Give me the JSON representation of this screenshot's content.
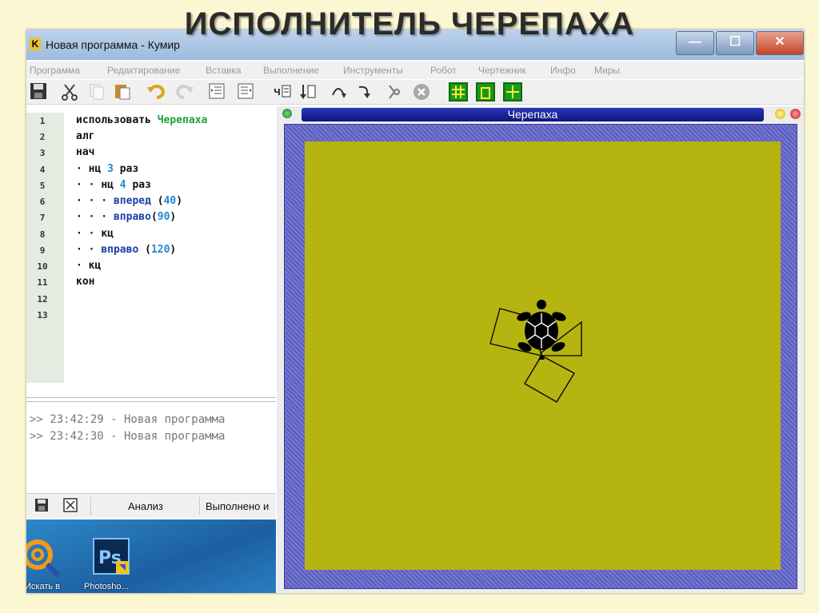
{
  "slide": {
    "title": "ИСПОЛНИТЕЛЬ ЧЕРЕПАХА"
  },
  "window": {
    "app_icon": "K",
    "title": "Новая программа - Кумир",
    "minimize": "—",
    "maximize": "☐",
    "close": "✕"
  },
  "menu": [
    "Программа",
    "Редактирование",
    "Вставка",
    "Выполнение",
    "Инструменты",
    "Робот",
    "Чертежник",
    "Инфо",
    "Миры"
  ],
  "toolbar_icons": [
    "save-icon",
    "cut-icon",
    "copy-icon",
    "paste-icon",
    "undo-icon",
    "redo-icon",
    "indent-icon",
    "outdent-icon",
    "run-icon",
    "step-icon",
    "step-into-icon",
    "step-out-icon",
    "debug-icon",
    "stop-icon",
    "grid-icon",
    "frame-icon",
    "cross-icon"
  ],
  "editor": {
    "line_numbers": [
      "1",
      "2",
      "3",
      "4",
      "5",
      "6",
      "7",
      "8",
      "9",
      "10",
      "11",
      "12",
      "13"
    ],
    "lines": [
      {
        "indent": "",
        "kw": "использовать ",
        "name": "Черепаха"
      },
      {
        "indent": "",
        "kw": "алг"
      },
      {
        "indent": "",
        "kw": "нач"
      },
      {
        "indent": "· ",
        "kw": "нц ",
        "num": "3",
        "rest": " раз"
      },
      {
        "indent": "· · ",
        "kw": "нц ",
        "num": "4",
        "rest": " раз"
      },
      {
        "indent": "· · · ",
        "cmd": "вперед",
        "open": " (",
        "num": "40",
        "close": ")"
      },
      {
        "indent": "· · · ",
        "cmd": "вправо",
        "open": "(",
        "num": "90",
        "close": ")"
      },
      {
        "indent": "· · ",
        "kw": "кц"
      },
      {
        "indent": "· · ",
        "cmd": "вправо",
        "open": " (",
        "num": "120",
        "close": ")"
      },
      {
        "indent": "· ",
        "kw": "кц"
      },
      {
        "indent": "",
        "kw": "кон"
      }
    ]
  },
  "console": [
    ">> 23:42:29 - Новая программа",
    ">> 23:42:30 - Новая программа"
  ],
  "statusbar": {
    "analysis_label": "Анализ",
    "status_text": "Выполнено и"
  },
  "taskbar": [
    {
      "label": "Искать в",
      "icon": "at-search-icon"
    },
    {
      "label": "Photosho...",
      "icon": "photoshop-icon",
      "icon_text": "Ps"
    }
  ],
  "turtle_window": {
    "title": "Черепаха",
    "canvas_color": "#b5b410",
    "frame_color": "#5a5cc2"
  },
  "colors": {
    "keyword": "#111111",
    "library_name": "#1aa13a",
    "number": "#1e88d8",
    "command": "#1a3fa8"
  }
}
